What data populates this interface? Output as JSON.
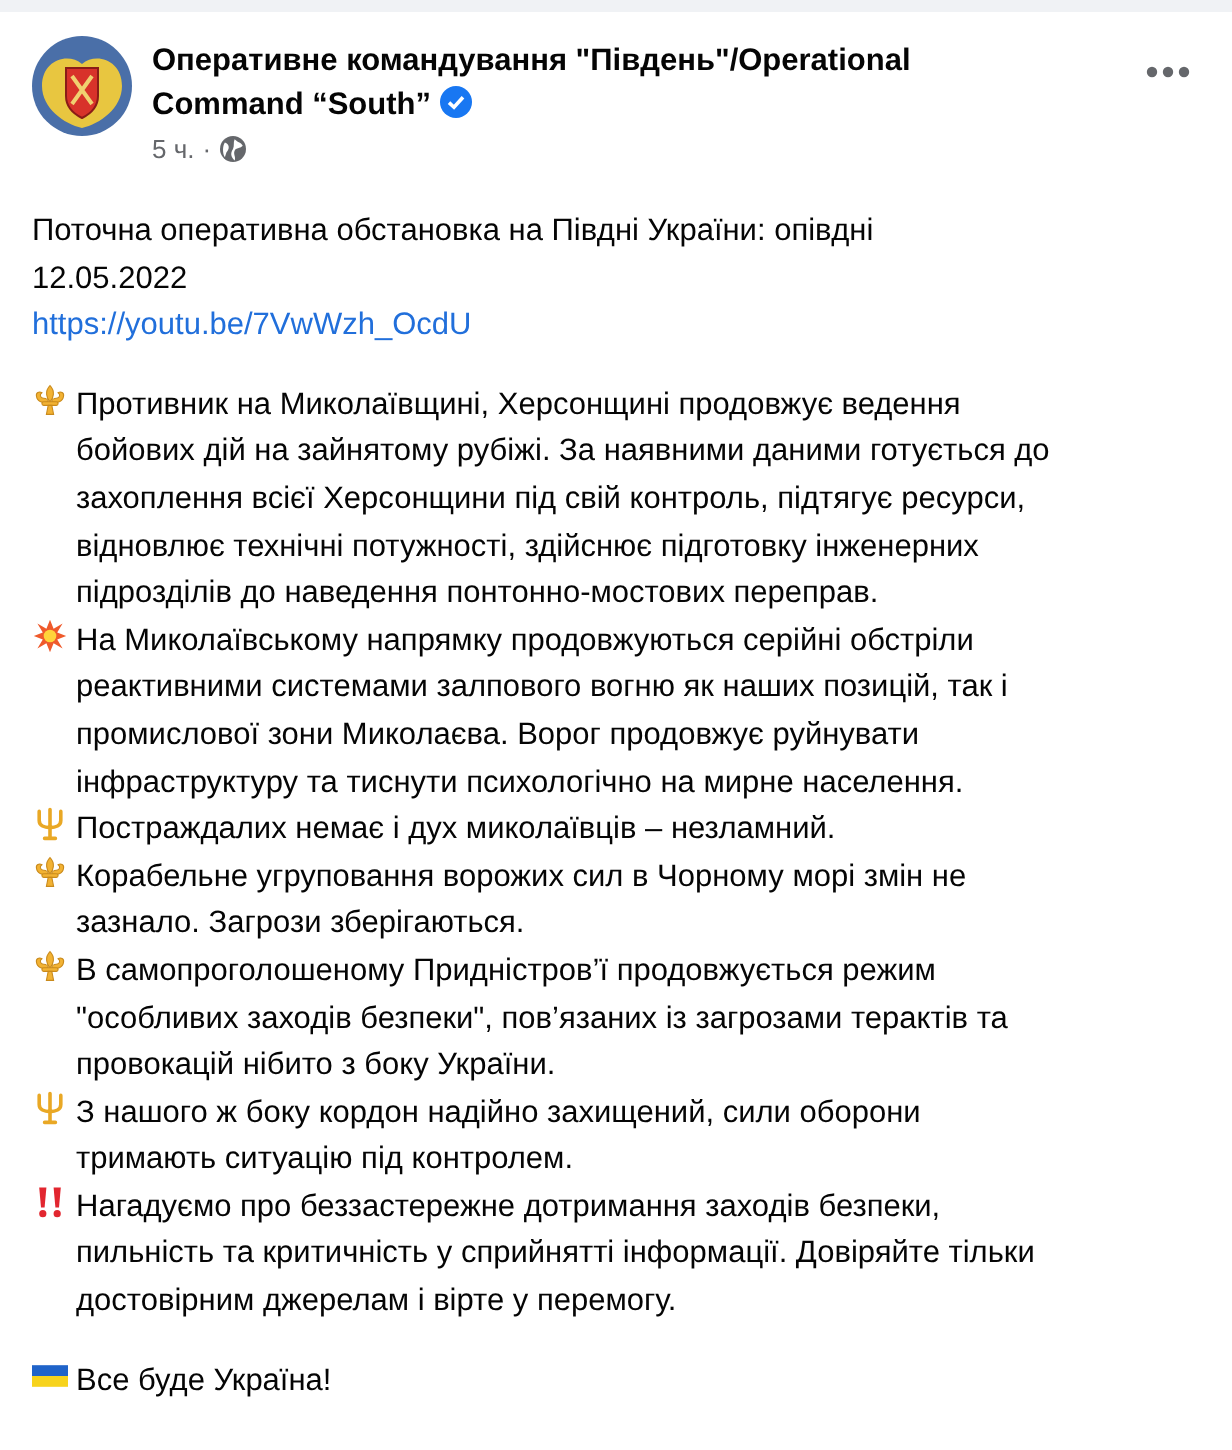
{
  "post": {
    "author_lines": [
      "Оперативне командування \"Південь\"/Operational",
      "Command “South”"
    ],
    "verified": true,
    "time": "5 ч.",
    "separator": "·",
    "intro": [
      "Поточна оперативна обстановка на Півдні України: опівдні",
      "12.05.2022"
    ],
    "link": "https://youtu.be/7VwWzh_OcdU",
    "items": [
      {
        "kind": "fleur",
        "lines": [
          "Противник на Миколаївщині, Херсонщині продовжує ведення",
          "бойових дій на зайнятому рубіжі. За наявними даними готується до",
          "захоплення всієї Херсонщини під свій контроль, підтягує ресурси,",
          "відновлює технічні потужності, здійснює підготовку інженерних",
          "підрозділів до наведення понтонно-мостових переправ."
        ]
      },
      {
        "kind": "burst",
        "lines": [
          "На Миколаївському напрямку продовжуються серійні обстріли",
          "реактивними системами залпового вогню як наших позицій, так і",
          "промислової зони Миколаєва.  Ворог продовжує руйнувати",
          "інфраструктуру та тиснути психологічно на мирне населення."
        ]
      },
      {
        "kind": "trident",
        "lines": [
          "Постраждалих немає і дух миколаївців – незламний."
        ]
      },
      {
        "kind": "fleur",
        "lines": [
          "Корабельне угруповання ворожих сил в Чорному морі змін не",
          "зазнало. Загрози зберігаються."
        ]
      },
      {
        "kind": "fleur",
        "lines": [
          "В самопроголошеному Придністров’ї продовжується режим",
          "\"особливих заходів безпеки\", пов’язаних із загрозами терактів та",
          "провокацій нібито з боку України."
        ]
      },
      {
        "kind": "trident",
        "lines": [
          "З нашого ж боку кордон надійно захищений, сили оборони",
          "тримають ситуацію під контролем."
        ]
      },
      {
        "kind": "alert",
        "lines": [
          "Нагадуємо про беззастережне дотримання заходів безпеки,",
          "пильність та критичність у сприйнятті інформації. Довіряйте тільки",
          "достовірним джерелам і вірте у перемогу."
        ]
      }
    ],
    "closing": {
      "kind": "flag",
      "text": "Все буде Україна!"
    }
  }
}
